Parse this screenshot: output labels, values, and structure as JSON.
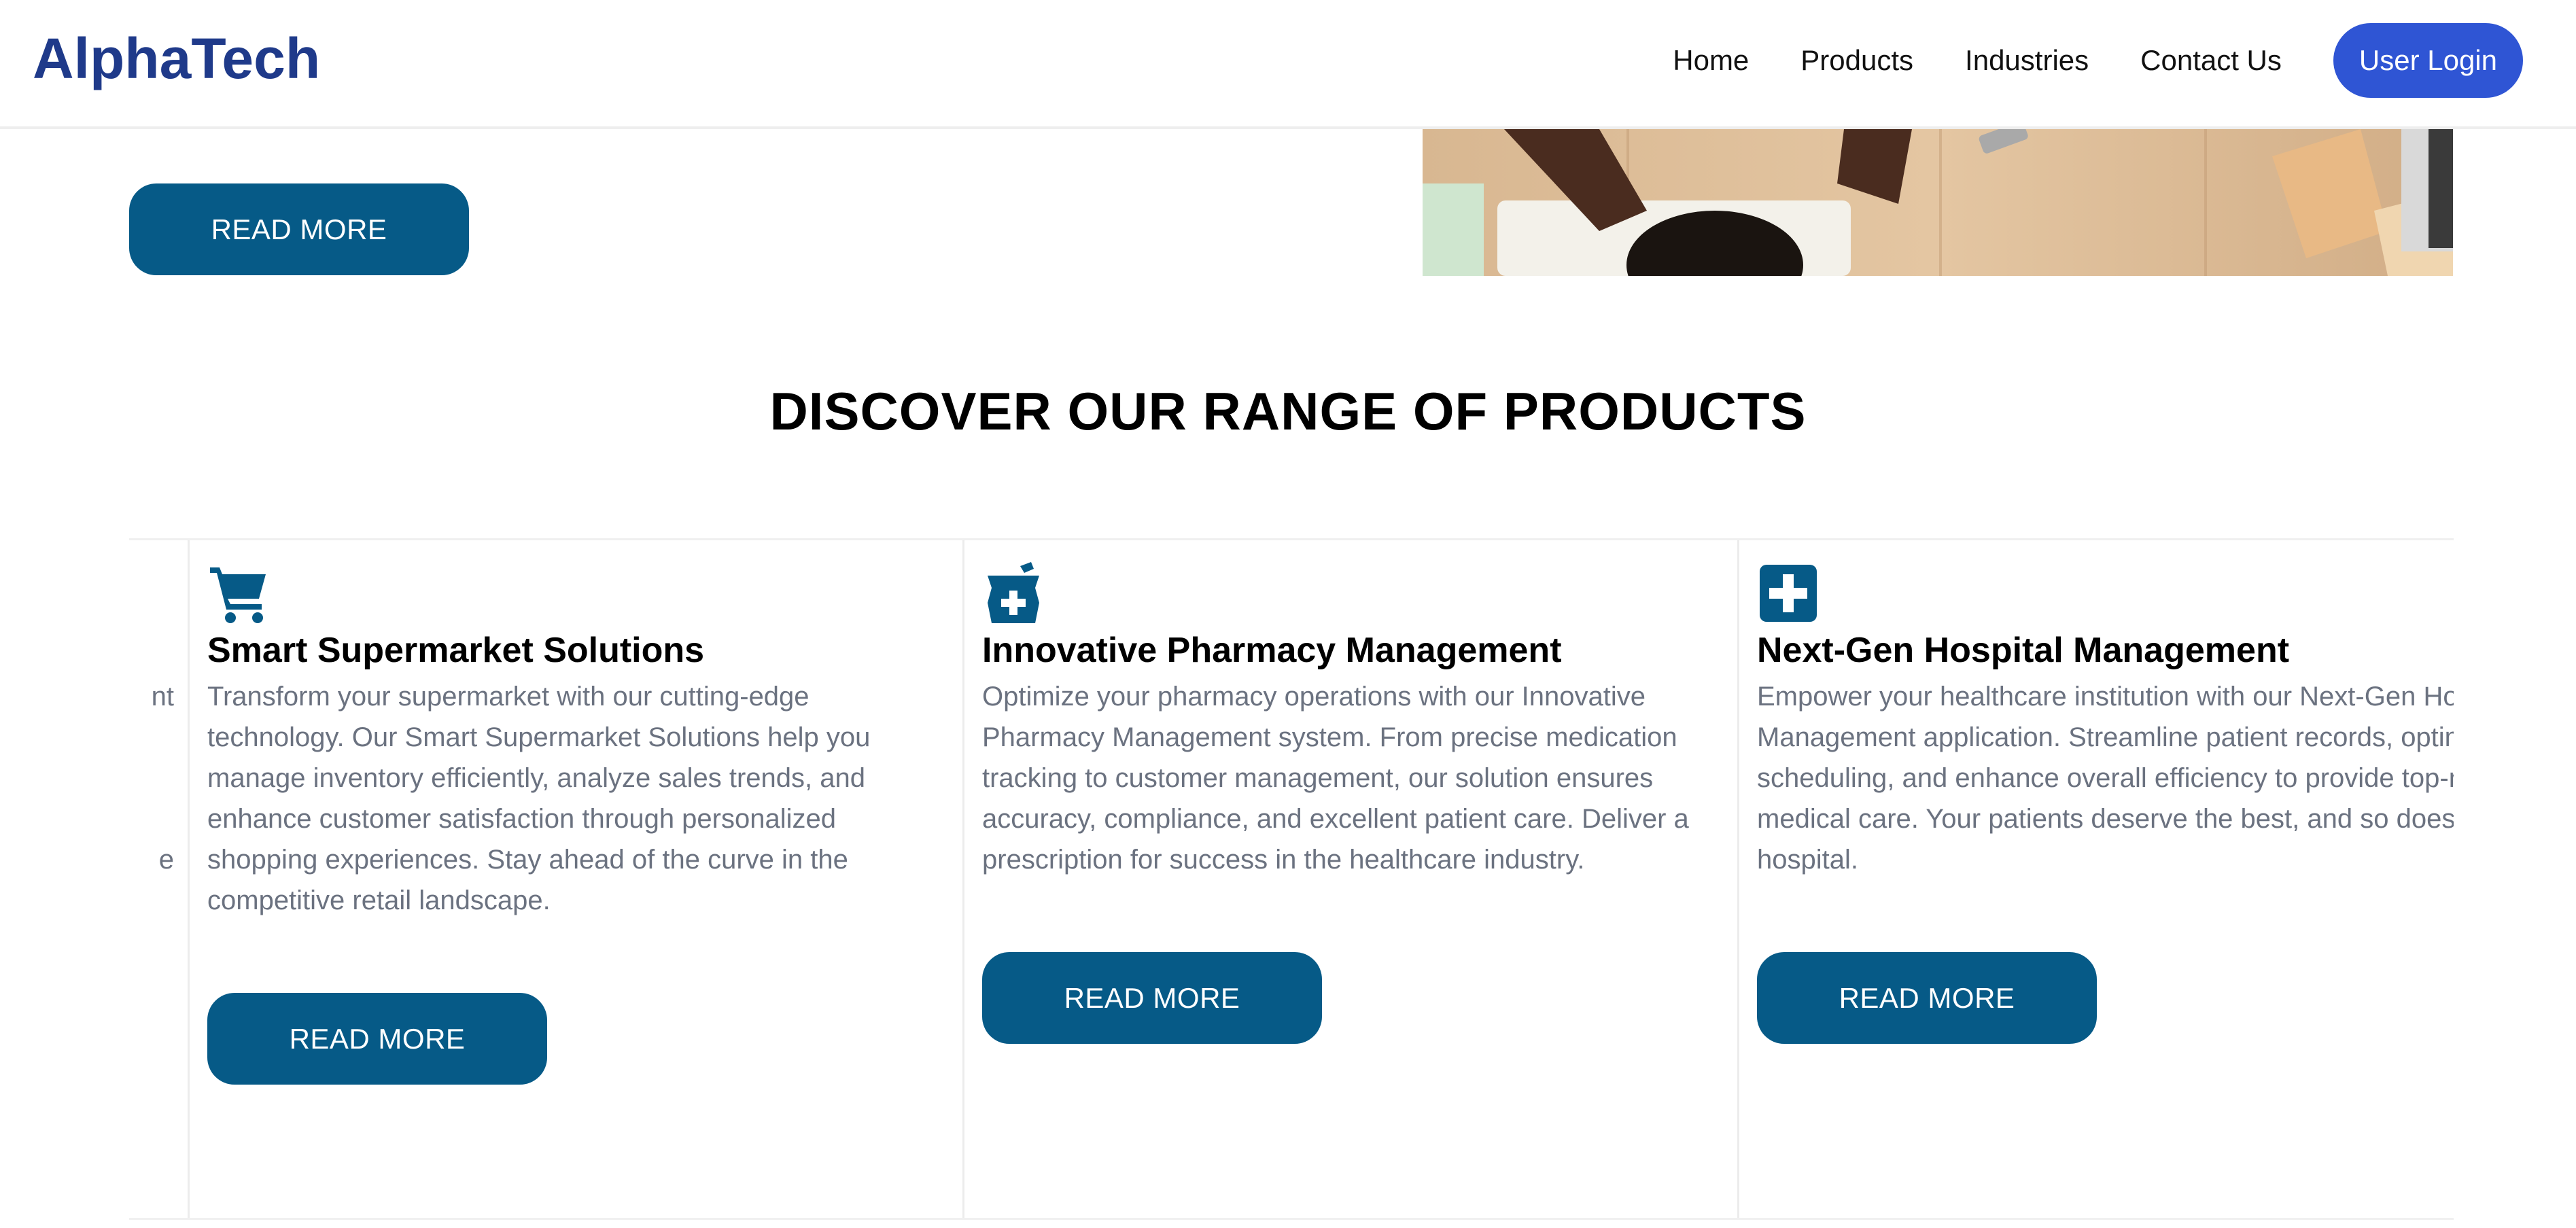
{
  "header": {
    "logo": "AlphaTech",
    "nav": [
      "Home",
      "Products",
      "Industries",
      "Contact Us"
    ],
    "login_label": "User Login"
  },
  "hero": {
    "read_more_label": "READ MORE"
  },
  "products_section": {
    "title": "DISCOVER OUR RANGE OF PRODUCTS",
    "partial_card_fragments": [
      "nt",
      "e"
    ],
    "cards": [
      {
        "icon": "shopping-cart-icon",
        "title": "Smart Supermarket Solutions",
        "description": "Transform your supermarket with our cutting-edge technology. Our Smart Supermarket Solutions help you manage inventory efficiently, analyze sales trends, and enhance customer satisfaction through personalized shopping experiences. Stay ahead of the curve in the competitive retail landscape.",
        "button_label": "READ MORE"
      },
      {
        "icon": "pharmacy-mortar-icon",
        "title": "Innovative Pharmacy Management",
        "description": "Optimize your pharmacy operations with our Innovative Pharmacy Management system. From precise medication tracking to customer management, our solution ensures accuracy, compliance, and excellent patient care. Deliver a prescription for success in the healthcare industry.",
        "button_label": "READ MORE"
      },
      {
        "icon": "hospital-plus-icon",
        "title": "Next-Gen Hospital Management",
        "description": "Empower your healthcare institution with our Next-Gen Hospital Management application. Streamline patient records, optimize scheduling, and enhance overall efficiency to provide top-notch medical care. Your patients deserve the best, and so does your hospital.",
        "button_label": "READ MORE"
      }
    ]
  },
  "colors": {
    "brand": "#1f3a8a",
    "login_button": "#2f55d4",
    "primary_button": "#065a87",
    "icon": "#065a87",
    "body_text": "#6b7280"
  }
}
